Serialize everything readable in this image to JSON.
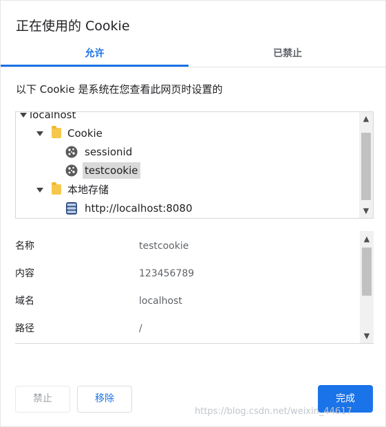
{
  "dialog": {
    "title": "正在使用的 Cookie"
  },
  "tabs": [
    {
      "label": "允许",
      "active": true
    },
    {
      "label": "已禁止",
      "active": false
    }
  ],
  "description": "以下 Cookie 是系统在您查看此网页时设置的",
  "tree": {
    "root": "localhost",
    "cookie_folder": "Cookie",
    "cookies": [
      "sessionid",
      "testcookie"
    ],
    "selected": "testcookie",
    "storage_folder": "本地存储",
    "storage_items": [
      "http://localhost:8080"
    ]
  },
  "details": [
    {
      "label": "名称",
      "value": "testcookie"
    },
    {
      "label": "内容",
      "value": "123456789"
    },
    {
      "label": "域名",
      "value": "localhost"
    },
    {
      "label": "路径",
      "value": "/"
    }
  ],
  "buttons": {
    "block": "禁止",
    "remove": "移除",
    "done": "完成"
  },
  "watermark": "https://blog.csdn.net/weixin_44617",
  "colors": {
    "accent": "#1a73e8",
    "selection": "#d9d9d9",
    "folder": "#f5c84c"
  }
}
